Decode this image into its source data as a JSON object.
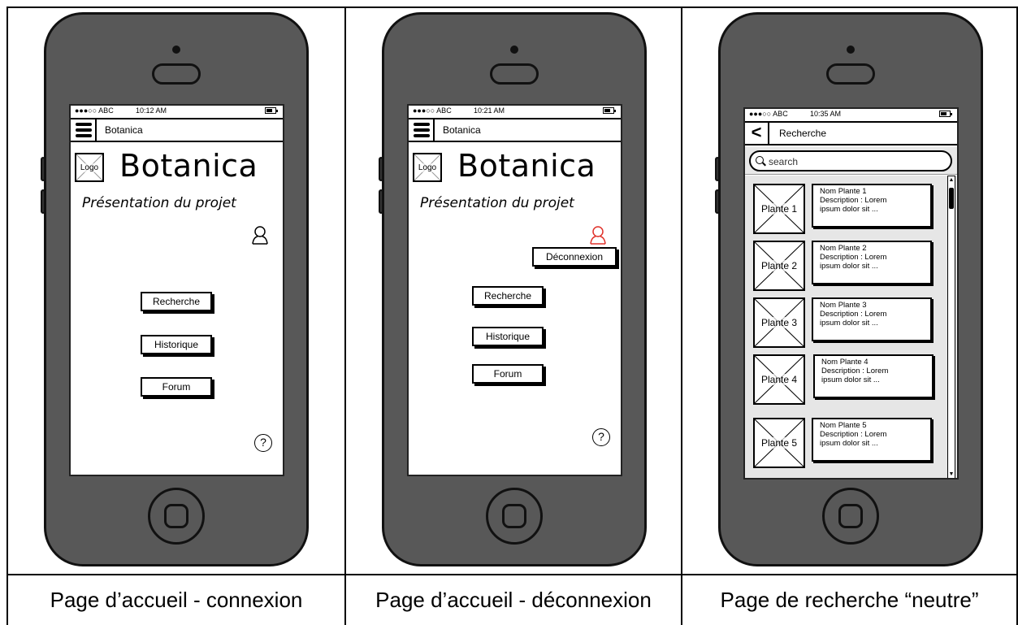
{
  "captions": [
    "Page d’accueil - connexion",
    "Page d’accueil - déconnexion",
    "Page de recherche “neutre”"
  ],
  "status": {
    "signal": "●●●○○ ABC"
  },
  "phones": [
    {
      "time": "10:12 AM",
      "nav_title": "Botanica",
      "logo_label": "Logo",
      "brand": "Botanica",
      "subtitle": "Présentation du projet",
      "buttons": [
        "Recherche",
        "Historique",
        "Forum"
      ],
      "help": "?"
    },
    {
      "time": "10:21 AM",
      "nav_title": "Botanica",
      "logo_label": "Logo",
      "brand": "Botanica",
      "subtitle": "Présentation du projet",
      "logout": "Déconnexion",
      "buttons": [
        "Recherche",
        "Historique",
        "Forum"
      ],
      "help": "?",
      "user_color": "#e0322b"
    },
    {
      "time": "10:35 AM",
      "nav_title": "Recherche",
      "search_placeholder": "search",
      "items": [
        {
          "thumb": "Plante 1",
          "name": "Nom Plante 1",
          "desc1": "Description : Lorem",
          "desc2": "ipsum dolor sit ..."
        },
        {
          "thumb": "Plante 2",
          "name": "Nom Plante 2",
          "desc1": "Description : Lorem",
          "desc2": "ipsum dolor sit ..."
        },
        {
          "thumb": "Plante 3",
          "name": "Nom Plante 3",
          "desc1": "Description : Lorem",
          "desc2": "ipsum dolor sit ..."
        },
        {
          "thumb": "Plante 4",
          "name": "Nom Plante 4",
          "desc1": "Description : Lorem",
          "desc2": "ipsum dolor sit ..."
        },
        {
          "thumb": "Plante 5",
          "name": "Nom Plante 5",
          "desc1": "Description : Lorem",
          "desc2": "ipsum dolor sit ..."
        }
      ]
    }
  ]
}
